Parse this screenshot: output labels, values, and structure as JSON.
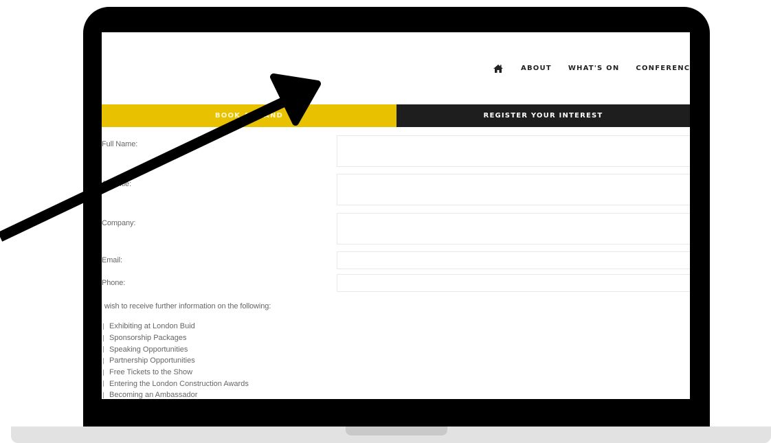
{
  "nav": {
    "items": [
      {
        "label": "ABOUT"
      },
      {
        "label": "WHAT'S ON"
      },
      {
        "label": "CONFERENCE"
      }
    ]
  },
  "tabs": {
    "book": "BOOK A STAND",
    "register": "REGISTER YOUR INTEREST"
  },
  "form": {
    "full_name_label": "Full Name:",
    "job_title_label": "Job Title:",
    "company_label": "Company:",
    "email_label": "Email:",
    "phone_label": "Phone:",
    "interest_prompt": "I wish to receive further information on the following:",
    "options": [
      {
        "label": "Exhibiting at London Buid"
      },
      {
        "label": "Sponsorship Packages"
      },
      {
        "label": "Speaking Opportunities"
      },
      {
        "label": "Partnership Opportunities"
      },
      {
        "label": "Free Tickets to the Show"
      },
      {
        "label": "Entering the London Construction Awards"
      },
      {
        "label": "Becoming an Ambassador"
      }
    ]
  },
  "colors": {
    "accent": "#e8c200",
    "dark": "#1e1e1e",
    "frame": "#000000"
  },
  "icons": {
    "home": "home-icon",
    "annotation": "arrow-pointer-icon"
  }
}
